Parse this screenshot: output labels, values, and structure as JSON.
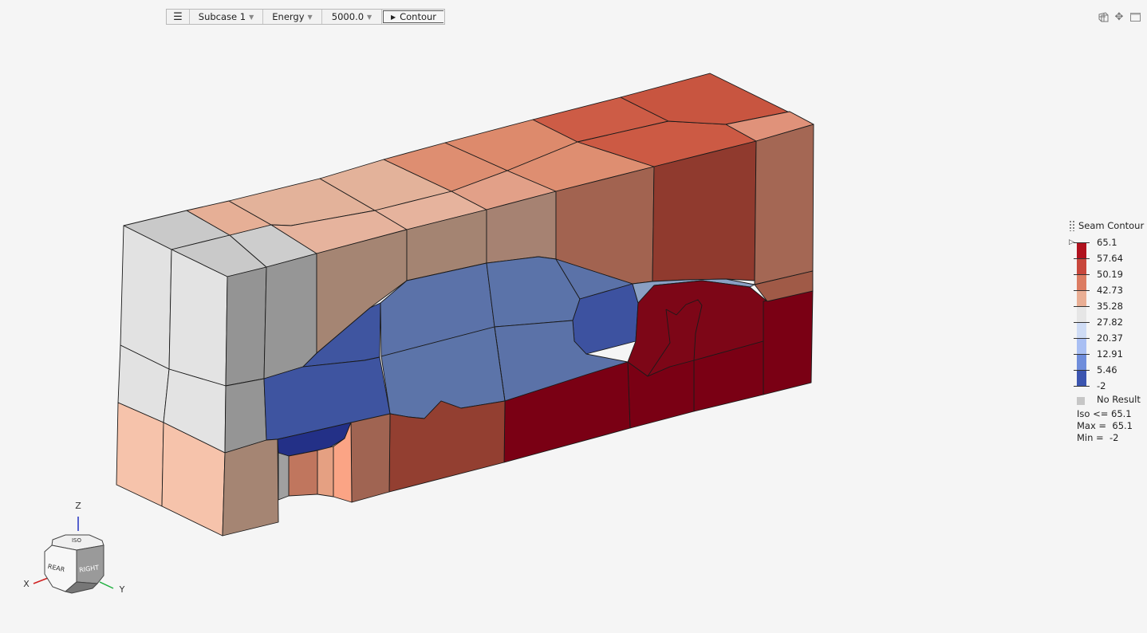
{
  "toolbar": {
    "menu_icon": "☰",
    "subcase": "Subcase 1",
    "result_type": "Energy",
    "time": "5000.0",
    "contour_label": "Contour"
  },
  "top_icons": [
    "grid-icon",
    "move-icon",
    "window-icon"
  ],
  "legend": {
    "title": "Seam Contour",
    "levels": [
      "65.1",
      "57.64",
      "50.19",
      "42.73",
      "35.28",
      "27.82",
      "20.37",
      "12.91",
      "5.46",
      "-2"
    ],
    "colors": [
      "#b0121e",
      "#c8473c",
      "#dc7c62",
      "#e9ae94",
      "#e6e6e6",
      "#cfdcf5",
      "#a9bff3",
      "#6f8ddb",
      "#3c55b0",
      "#20308f"
    ],
    "no_result": "No Result",
    "iso": "Iso <= 65.1",
    "max": "Max =  65.1",
    "min": "Min =  -2",
    "marker": "▷"
  },
  "triad": {
    "x": "X",
    "y": "Y",
    "z": "Z",
    "face_front": "REAR",
    "face_side": "RIGHT",
    "face_top": "ISO"
  },
  "model_colors": {
    "gray_top": "#c9c9c9",
    "gray_front": "#e2e2e2",
    "gray_side": "#949494",
    "peach": "#f5c3aa",
    "taupe": "#a58573",
    "brown_red": "#9a4a3a",
    "dark_red": "#7a0014",
    "blue": "#5b72a8",
    "dark_blue": "#3d52a0",
    "navy": "#233087"
  }
}
